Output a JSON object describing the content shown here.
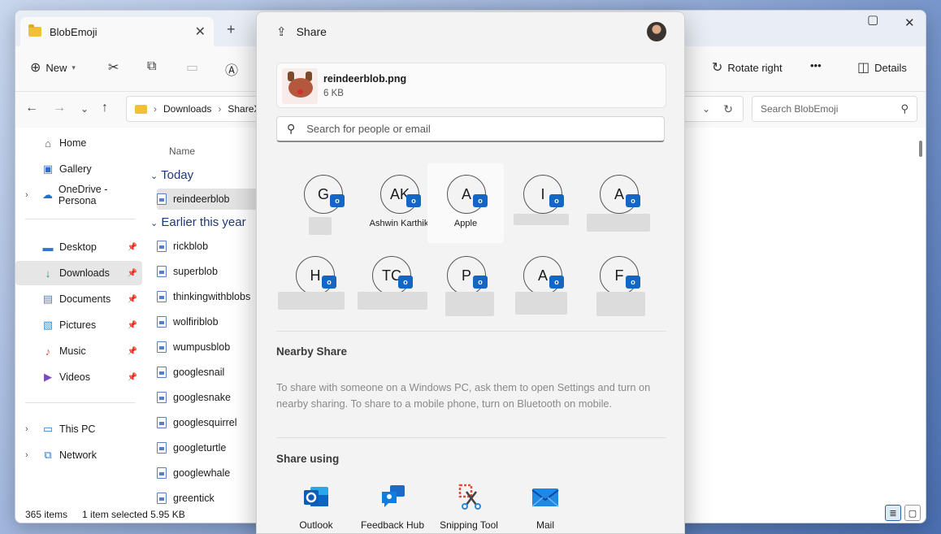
{
  "explorer": {
    "tab_title": "BlobEmoji",
    "new_tab": "+",
    "toolbar": {
      "new_label": "New",
      "rotate_right": "Rotate right",
      "more": "•••",
      "details": "Details"
    },
    "breadcrumb": [
      "Downloads",
      "ShareX"
    ],
    "search_placeholder": "Search BlobEmoji",
    "sidebar": {
      "home": "Home",
      "gallery": "Gallery",
      "onedrive": "OneDrive - Persona",
      "desktop": "Desktop",
      "downloads": "Downloads",
      "documents": "Documents",
      "pictures": "Pictures",
      "music": "Music",
      "videos": "Videos",
      "thispc": "This PC",
      "network": "Network"
    },
    "column_name": "Name",
    "group_today": "Today",
    "group_earlier": "Earlier this year",
    "files_today": [
      "reindeerblob"
    ],
    "files_earlier": [
      "rickblob",
      "superblob",
      "thinkingwithblobs",
      "wolfiriblob",
      "wumpusblob",
      "googlesnail",
      "googlesnake",
      "googlesquirrel",
      "googleturtle",
      "googlewhale",
      "greentick"
    ],
    "status": {
      "items": "365 items",
      "selected": "1 item selected  5.95 KB"
    }
  },
  "share": {
    "title": "Share",
    "file_name": "reindeerblob.png",
    "file_size": "6 KB",
    "search_placeholder": "Search for people or email",
    "contacts": [
      {
        "initials": "G",
        "name": ""
      },
      {
        "initials": "AK",
        "name": "Ashwin Karthik"
      },
      {
        "initials": "A",
        "name": "Apple"
      },
      {
        "initials": "I",
        "name": ""
      },
      {
        "initials": "A",
        "name": ""
      },
      {
        "initials": "H",
        "name": ""
      },
      {
        "initials": "TC",
        "name": ""
      },
      {
        "initials": "P",
        "name": ""
      },
      {
        "initials": "A",
        "name": ""
      },
      {
        "initials": "F",
        "name": ""
      }
    ],
    "nearby_title": "Nearby Share",
    "nearby_text": "To share with someone on a Windows PC, ask them to open Settings and turn on nearby sharing. To share to a mobile phone, turn on Bluetooth on mobile.",
    "share_using_title": "Share using",
    "apps": [
      "Outlook",
      "Feedback Hub",
      "Snipping Tool",
      "Mail"
    ]
  },
  "colors": {
    "outlook_blue": "#1466c4",
    "folder_yellow": "#f2c037",
    "accent_navy": "#1e3a78"
  }
}
